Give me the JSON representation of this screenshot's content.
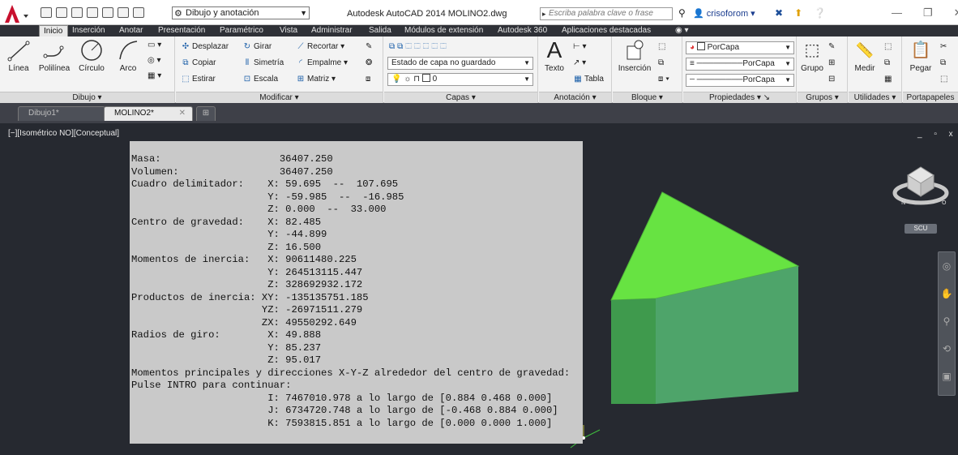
{
  "titlebar": {
    "workspace": "Dibujo y anotación",
    "window_title": "Autodesk AutoCAD 2014   MOLINO2.dwg",
    "search_placeholder": "Escriba palabra clave o frase",
    "user": "crisoforom"
  },
  "ribbon_tabs": [
    "Inicio",
    "Inserción",
    "Anotar",
    "Presentación",
    "Paramétrico",
    "Vista",
    "Administrar",
    "Salida",
    "Módulos de extensión",
    "Autodesk 360",
    "Aplicaciones destacadas"
  ],
  "ribbon": {
    "dibujo": {
      "title": "Dibujo",
      "tools": [
        "Línea",
        "Polilínea",
        "Círculo",
        "Arco"
      ]
    },
    "modificar": {
      "title": "Modificar",
      "tools": [
        "Desplazar",
        "Girar",
        "Recortar",
        "Copiar",
        "Simetría",
        "Empalme",
        "Estirar",
        "Escala",
        "Matriz"
      ]
    },
    "capas": {
      "title": "Capas",
      "state": "Estado de capa no guardado",
      "current": "0"
    },
    "anotacion": {
      "title": "Anotación",
      "texto": "Texto",
      "tabla": "Tabla"
    },
    "bloque": {
      "title": "Bloque",
      "insercion": "Inserción"
    },
    "propiedades": {
      "title": "Propiedades",
      "color": "PorCapa",
      "linetype": "PorCapa",
      "lineweight": "PorCapa"
    },
    "grupos": {
      "title": "Grupos",
      "grupo": "Grupo"
    },
    "utilidades": {
      "title": "Utilidades",
      "medir": "Medir"
    },
    "portapapeles": {
      "title": "Portapapeles",
      "pegar": "Pegar"
    }
  },
  "file_tabs": [
    "Dibujo1*",
    "MOLINO2*"
  ],
  "viewport": {
    "label": "[−][Isométrico NO][Conceptual]",
    "controls": "_ ▫ x",
    "ucs_label": "SCU"
  },
  "text_window": {
    "lines": [
      "Masa:                    36407.250",
      "Volumen:                 36407.250",
      "Cuadro delimitador:    X: 59.695  --  107.695",
      "                       Y: -59.985  --  -16.985",
      "                       Z: 0.000  --  33.000",
      "Centro de gravedad:    X: 82.485",
      "                       Y: -44.899",
      "                       Z: 16.500",
      "Momentos de inercia:   X: 90611480.225",
      "                       Y: 264513115.447",
      "                       Z: 328692932.172",
      "Productos de inercia: XY: -135135751.185",
      "                      YZ: -26971511.279",
      "                      ZX: 49550292.649",
      "Radios de giro:        X: 49.888",
      "                       Y: 85.237",
      "                       Z: 95.017",
      "Momentos principales y direcciones X-Y-Z alrededor del centro de gravedad:",
      "Pulse INTRO para continuar:",
      "                       I: 7467010.978 a lo largo de [0.884 0.468 0.000]",
      "                       J: 6734720.748 a lo largo de [-0.468 0.884 0.000]",
      "                       K: 7593815.851 a lo largo de [0.000 0.000 1.000]"
    ]
  },
  "colors": {
    "top_face": "#67e342",
    "front_face": "#4ea46a",
    "side_face": "#3d8e5a",
    "viewport_bg": "#262930"
  }
}
